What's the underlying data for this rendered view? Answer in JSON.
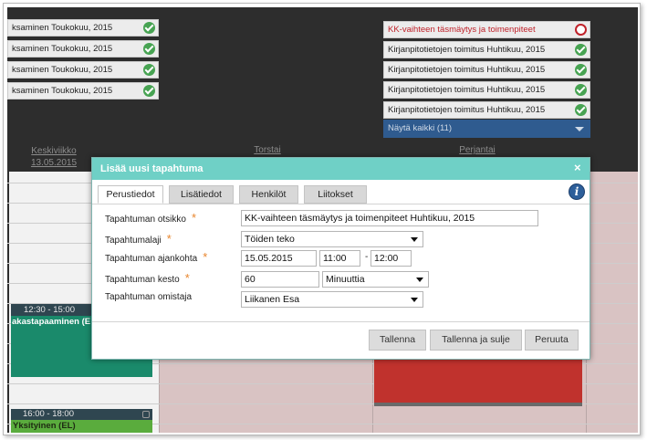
{
  "left_tasks": [
    {
      "label": "ksaminen Toukokuu, 2015",
      "status": "done"
    },
    {
      "label": "ksaminen Toukokuu, 2015",
      "status": "done"
    },
    {
      "label": "ksaminen Toukokuu, 2015",
      "status": "done"
    },
    {
      "label": "ksaminen Toukokuu, 2015",
      "status": "done"
    }
  ],
  "right_tasks": [
    {
      "label": "KK-vaihteen täsmäytys ja toimenpiteet",
      "status": "open"
    },
    {
      "label": "Kirjanpitotietojen toimitus Huhtikuu, 2015",
      "status": "done"
    },
    {
      "label": "Kirjanpitotietojen toimitus Huhtikuu, 2015",
      "status": "done"
    },
    {
      "label": "Kirjanpitotietojen toimitus Huhtikuu, 2015",
      "status": "done"
    },
    {
      "label": "Kirjanpitotietojen toimitus Huhtikuu, 2015",
      "status": "done"
    }
  ],
  "show_all": "Näytä kaikki (11)",
  "days": {
    "wednesday": {
      "name": "Keskiviikko",
      "date": "13.05.2015"
    },
    "thursday": {
      "name": "Torstai"
    },
    "friday": {
      "name": "Perjantai"
    }
  },
  "events": {
    "meeting": {
      "time": "12:30 - 15:00",
      "title": "akastapaaminen (E"
    },
    "private": {
      "time": "16:00 - 18:00",
      "title": "Yksityinen (EL)"
    }
  },
  "modal": {
    "title": "Lisää uusi tapahtuma",
    "close": "×",
    "info": "i",
    "tabs": [
      "Perustiedot",
      "Lisätiedot",
      "Henkilöt",
      "Liitokset"
    ],
    "labels": {
      "subject": "Tapahtuman otsikko",
      "type": "Tapahtumalaji",
      "when": "Tapahtuman ajankohta",
      "duration": "Tapahtuman kesto",
      "owner": "Tapahtuman omistaja"
    },
    "required_mark": "*",
    "values": {
      "subject": "KK-vaihteen täsmäytys ja toimenpiteet Huhtikuu, 2015",
      "type": "Töiden teko",
      "date": "15.05.2015",
      "start": "11:00",
      "time_separator": "-",
      "end": "12:00",
      "duration": "60",
      "duration_unit": "Minuuttia",
      "owner": "Liikanen Esa"
    },
    "buttons": {
      "save": "Tallenna",
      "save_close": "Tallenna ja sulje",
      "cancel": "Peruuta"
    }
  },
  "colors": {
    "title_bar": "#6fd0c6",
    "done": "#47a352",
    "open": "#c0222a",
    "required": "#e8862e"
  }
}
